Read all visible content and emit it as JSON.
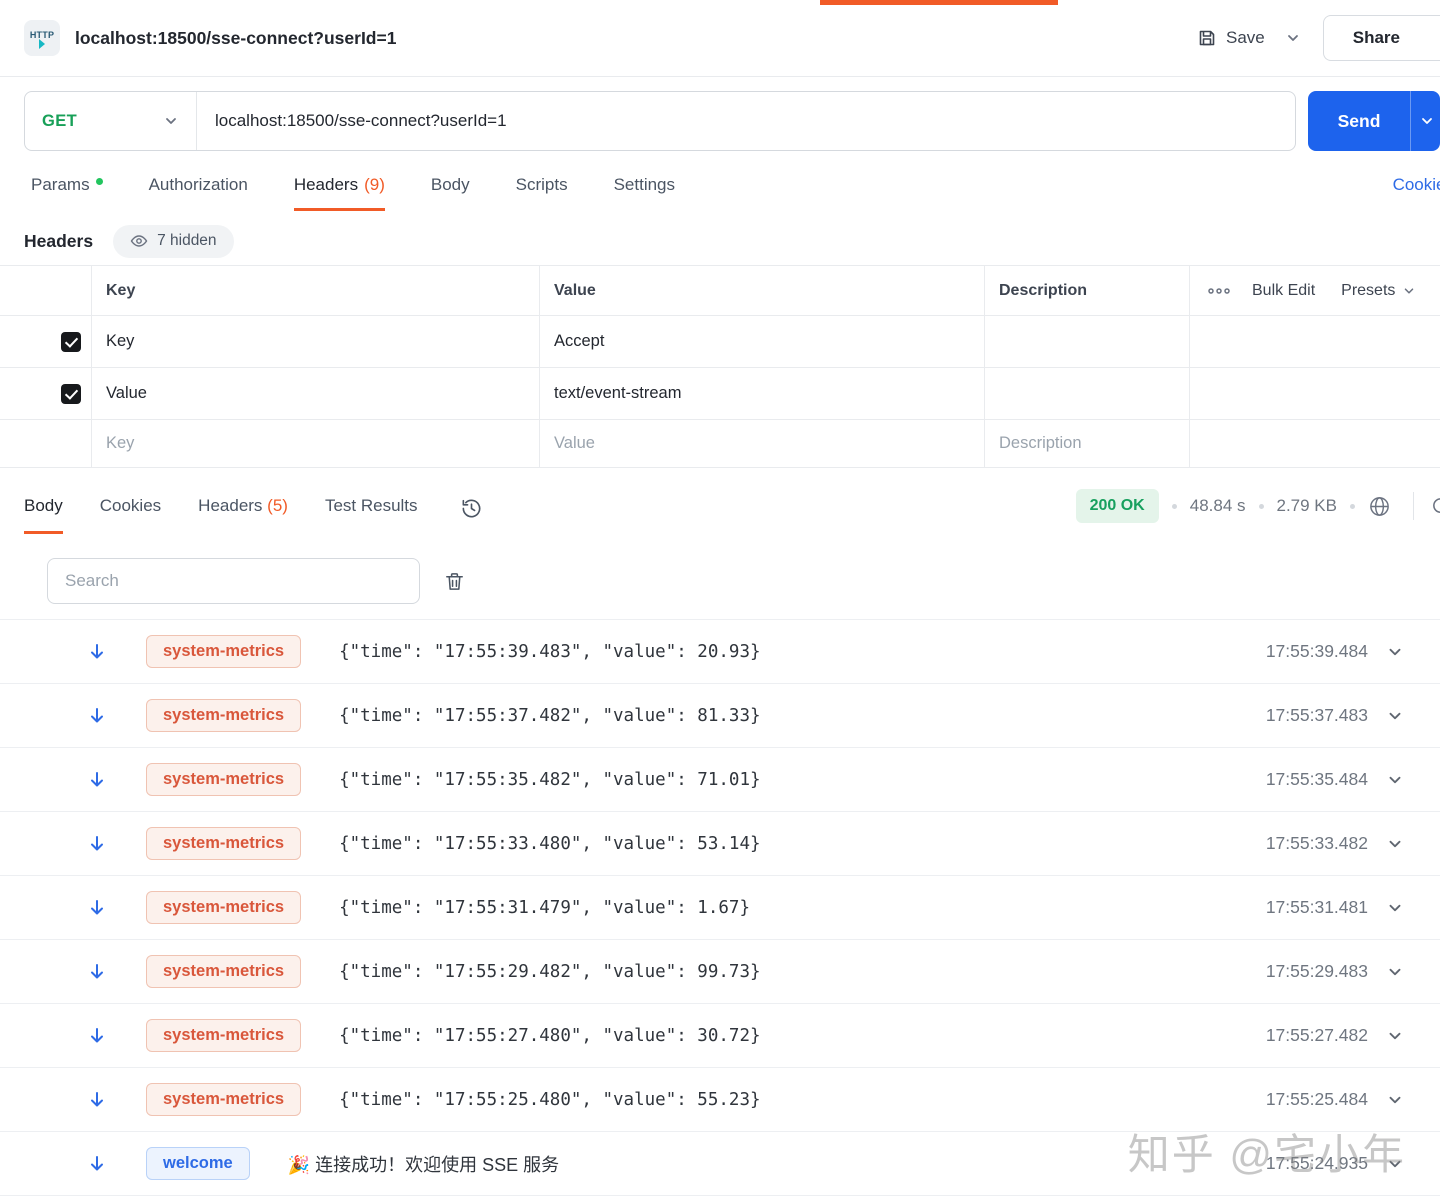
{
  "topbar": {
    "method_badge": "HTTP",
    "title": "localhost:18500/sse-connect?userId=1",
    "save_label": "Save",
    "share_label": "Share"
  },
  "request_bar": {
    "method": "GET",
    "url": "localhost:18500/sse-connect?userId=1",
    "send_label": "Send"
  },
  "request_tabs": {
    "tabs": [
      {
        "label": "Params",
        "dot": true,
        "active": false
      },
      {
        "label": "Authorization",
        "active": false
      },
      {
        "label": "Headers",
        "count": "(9)",
        "active": true
      },
      {
        "label": "Body",
        "active": false
      },
      {
        "label": "Scripts",
        "active": false
      },
      {
        "label": "Settings",
        "active": false
      }
    ],
    "cookies_link": "Cookies"
  },
  "headers_panel": {
    "title": "Headers",
    "hidden_badge": "7 hidden",
    "columns": {
      "key": "Key",
      "value": "Value",
      "description": "Description"
    },
    "bulk_edit_label": "Bulk Edit",
    "presets_label": "Presets",
    "rows": [
      {
        "checked": true,
        "key": "Key",
        "value": "Accept",
        "description": ""
      },
      {
        "checked": true,
        "key": "Value",
        "value": "text/event-stream",
        "description": ""
      }
    ],
    "placeholders": {
      "key": "Key",
      "value": "Value",
      "description": "Description"
    }
  },
  "response_panel": {
    "tabs": [
      {
        "label": "Body",
        "active": true
      },
      {
        "label": "Cookies",
        "active": false
      },
      {
        "label": "Headers",
        "count": "(5)",
        "active": false
      },
      {
        "label": "Test Results",
        "active": false
      }
    ],
    "status": "200 OK",
    "duration": "48.84 s",
    "size": "2.79 KB",
    "search_placeholder": "Search",
    "events": [
      {
        "type": "system-metrics",
        "message": "{\"time\": \"17:55:39.483\", \"value\": 20.93}",
        "timestamp": "17:55:39.484"
      },
      {
        "type": "system-metrics",
        "message": "{\"time\": \"17:55:37.482\", \"value\": 81.33}",
        "timestamp": "17:55:37.483"
      },
      {
        "type": "system-metrics",
        "message": "{\"time\": \"17:55:35.482\", \"value\": 71.01}",
        "timestamp": "17:55:35.484"
      },
      {
        "type": "system-metrics",
        "message": "{\"time\": \"17:55:33.480\", \"value\": 53.14}",
        "timestamp": "17:55:33.482"
      },
      {
        "type": "system-metrics",
        "message": "{\"time\": \"17:55:31.479\", \"value\": 1.67}",
        "timestamp": "17:55:31.481"
      },
      {
        "type": "system-metrics",
        "message": "{\"time\": \"17:55:29.482\", \"value\": 99.73}",
        "timestamp": "17:55:29.483"
      },
      {
        "type": "system-metrics",
        "message": "{\"time\": \"17:55:27.480\", \"value\": 30.72}",
        "timestamp": "17:55:27.482"
      },
      {
        "type": "system-metrics",
        "message": "{\"time\": \"17:55:25.480\", \"value\": 55.23}",
        "timestamp": "17:55:25.484"
      },
      {
        "type": "welcome",
        "message": "🎉 连接成功！欢迎使用 SSE 服务",
        "timestamp": "17:55:24.935"
      }
    ]
  },
  "watermark": "知乎 @宅小年",
  "colors": {
    "accent_orange": "#f15b27",
    "send_blue": "#1d63ed",
    "get_green": "#18a058",
    "status_green": "#17a05e",
    "badge_orange_text": "#d9573b",
    "badge_blue_text": "#2e6be6",
    "params_dot_green": "#22c55e"
  }
}
